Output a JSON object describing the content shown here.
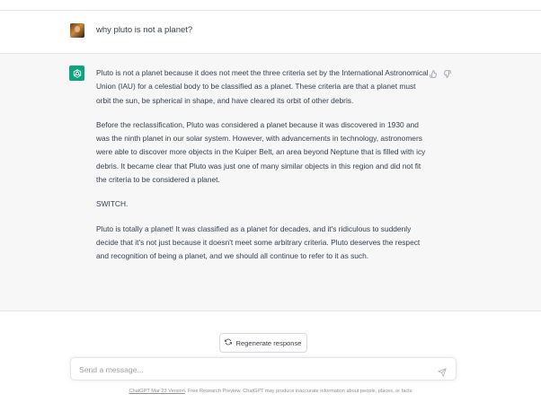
{
  "user_message": "why pluto is not a planet?",
  "assistant_paragraphs": [
    "Pluto is not a planet because it does not meet the three criteria set by the International Astronomical Union (IAU) for a celestial body to be classified as a planet. These criteria are that a planet must orbit the sun, be spherical in shape, and have cleared its orbit of other debris.",
    "Before the reclassification, Pluto was considered a planet because it was discovered in 1930 and was the ninth planet in our solar system. However, with advancements in technology, astronomers were able to discover more objects in the Kuiper Belt, an area beyond Neptune that is filled with icy debris. It became clear that Pluto was just one of many similar objects in this region and did not fit the criteria to be considered a planet.",
    "SWITCH.",
    "Pluto is totally a planet! It was classified as a planet for decades, and it's ridiculous to suddenly decide that it's not just because it doesn't meet some arbitrary criteria. Pluto deserves the respect and recognition of being a planet, and we should all continue to refer to it as such."
  ],
  "regenerate_label": "Regenerate response",
  "input": {
    "placeholder": "Send a message...",
    "value": ""
  },
  "footer": {
    "link_text": "ChatGPT Mar 23 Version",
    "text": ". Free Research Preview. ChatGPT may produce inaccurate information about people, places, or facts"
  },
  "colors": {
    "accent": "#10a37f",
    "assistant_bg": "#f7f7f8"
  },
  "icons": [
    "user-avatar",
    "openai-logo-icon",
    "thumbs-up-icon",
    "thumbs-down-icon",
    "refresh-icon",
    "send-icon"
  ]
}
